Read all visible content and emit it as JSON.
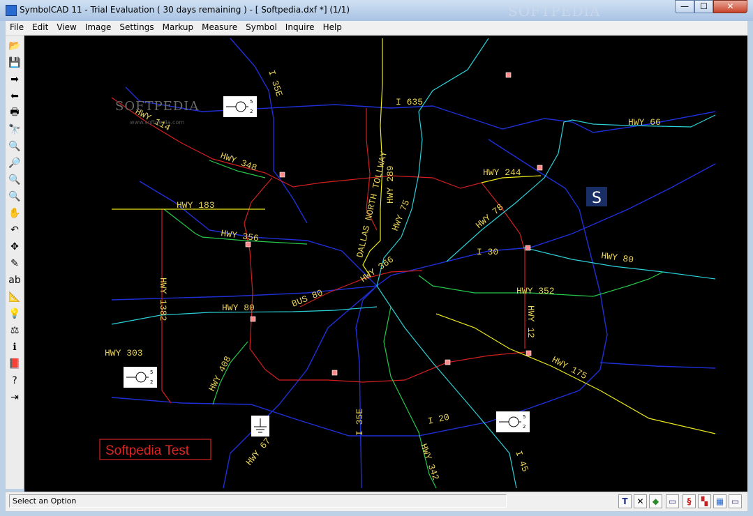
{
  "window": {
    "title": "SymbolCAD 11 - Trial Evaluation ( 30 days remaining )  -  [ Softpedia.dxf *] (1/1)",
    "watermark": "SOFTPEDIA",
    "minimize": "—",
    "maximize": "☐",
    "close": "✕"
  },
  "menu": [
    "File",
    "Edit",
    "View",
    "Image",
    "Settings",
    "Markup",
    "Measure",
    "Symbol",
    "Inquire",
    "Help"
  ],
  "toolbar": {
    "icons": [
      "open-folder-icon",
      "save-icon",
      "forward-arrow-icon",
      "back-arrow-icon",
      "print-icon",
      "binoculars-icon",
      "zoom-icon",
      "zoom-in-icon",
      "zoom-out-icon",
      "zoom-window-icon",
      "pan-hand-icon",
      "undo-icon",
      "move-icon",
      "pencil-icon",
      "text-ab-icon",
      "measure-icon",
      "bulb-icon",
      "scale-icon",
      "info-icon",
      "book-icon",
      "help-icon",
      "exit-icon"
    ],
    "glyphs": [
      "📂",
      "💾",
      "➡",
      "⬅",
      "🖶",
      "🔭",
      "🔍",
      "🔎",
      "🔍",
      "🔍",
      "✋",
      "↶",
      "✥",
      "✎",
      "ab",
      "📐",
      "💡",
      "⚖",
      "ℹ",
      "📕",
      "?",
      "⇥"
    ]
  },
  "map": {
    "road_labels": [
      "HWY 114",
      "I 35E",
      "I 635",
      "HWY 66",
      "HWY 348",
      "DALLAS NORTH TOLLWAY",
      "HWY 289",
      "HWY 244",
      "HWY 183",
      "HWY 356",
      "HWY 75",
      "HWY 78",
      "I 30",
      "HWY 80",
      "HWY 366",
      "HWY 352",
      "BUS 80",
      "HWY 80",
      "HWY 1382",
      "HWY 12",
      "HWY 303",
      "HWY 408",
      "HWY 175",
      "I 35E",
      "I 20",
      "HWY 67",
      "HWY 342",
      "I 45"
    ],
    "softpedia_logo": "SOFTPEDIA",
    "softpedia_url": "www.softpedia.com",
    "s_badge": "S",
    "test_label": "Softpedia Test",
    "symbol_sub": [
      "5",
      "2"
    ]
  },
  "status": {
    "text": "Select an Option",
    "buttons": [
      "T",
      "✕",
      "◆",
      "▭",
      "§",
      "▚",
      "▦",
      "▭"
    ]
  }
}
